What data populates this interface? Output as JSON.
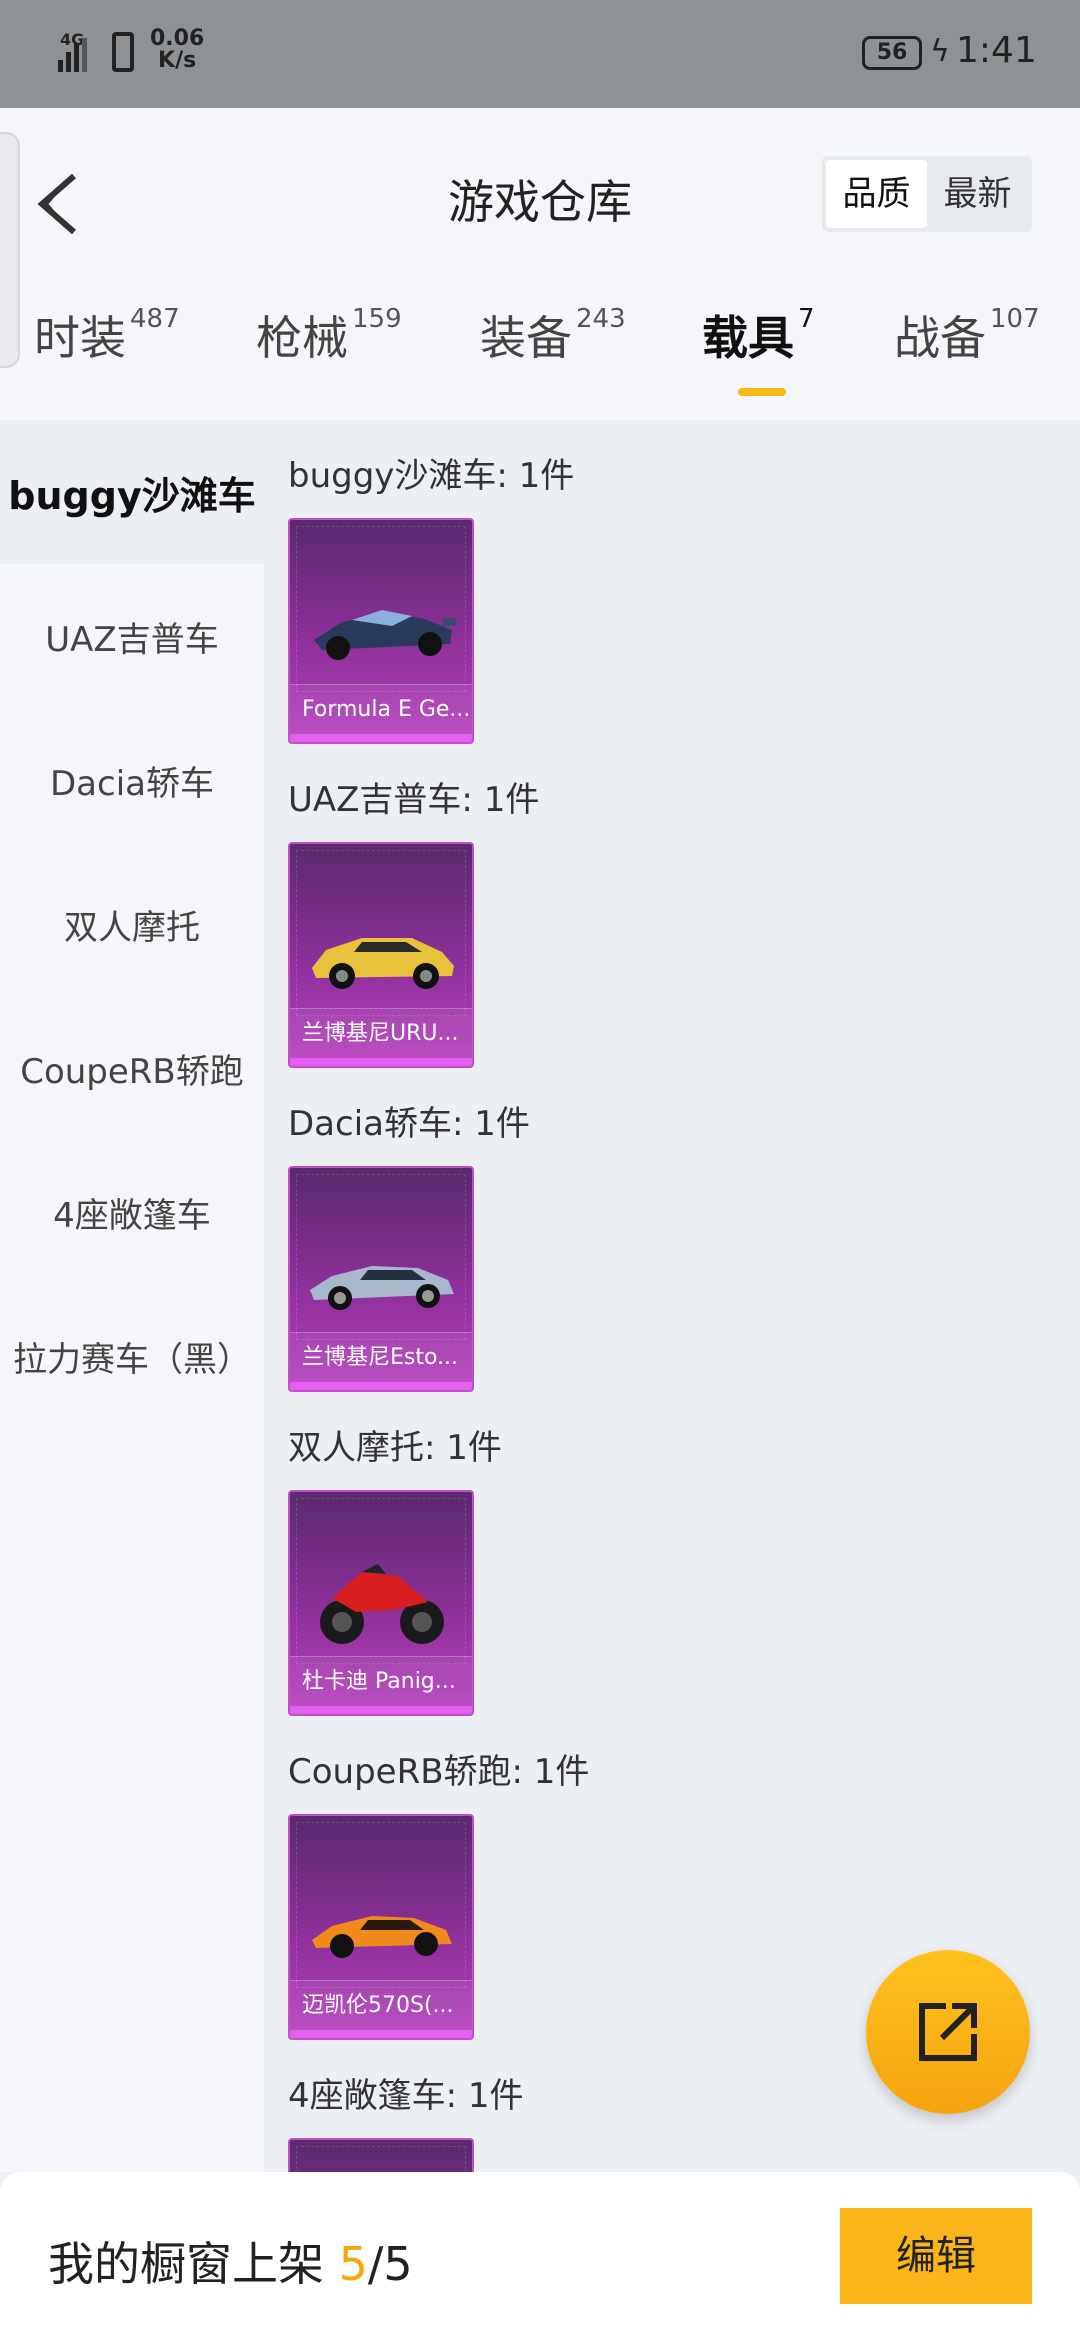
{
  "status_bar": {
    "network": "4G",
    "speed_value": "0.06",
    "speed_unit": "K/s",
    "battery": "56",
    "time": "1:41"
  },
  "header": {
    "title": "游戏仓库",
    "sort_options": [
      "品质",
      "最新"
    ],
    "active_sort": "品质"
  },
  "tabs": [
    {
      "label": "时装",
      "count": "487"
    },
    {
      "label": "枪械",
      "count": "159"
    },
    {
      "label": "装备",
      "count": "243"
    },
    {
      "label": "载具",
      "count": "7"
    },
    {
      "label": "战备",
      "count": "107"
    }
  ],
  "active_tab": "载具",
  "sidebar": {
    "items": [
      {
        "label": "buggy沙滩车"
      },
      {
        "label": "UAZ吉普车"
      },
      {
        "label": "Dacia轿车"
      },
      {
        "label": "双人摩托"
      },
      {
        "label": "CoupeRB轿跑"
      },
      {
        "label": "4座敞篷车"
      },
      {
        "label": "拉力赛车（黑）"
      }
    ],
    "active": "buggy沙滩车"
  },
  "groups": [
    {
      "title": "buggy沙滩车: 1件",
      "item_name": "Formula E Ge...",
      "icon": "formula-car-icon"
    },
    {
      "title": "UAZ吉普车: 1件",
      "item_name": "兰博基尼URU...",
      "icon": "yellow-suv-icon"
    },
    {
      "title": "Dacia轿车: 1件",
      "item_name": "兰博基尼Esto...",
      "icon": "silver-car-icon"
    },
    {
      "title": "双人摩托: 1件",
      "item_name": "杜卡迪 Panig...",
      "icon": "red-motorcycle-icon"
    },
    {
      "title": "CoupeRB轿跑: 1件",
      "item_name": "迈凯伦570S(...",
      "icon": "orange-car-icon"
    },
    {
      "title": "4座敞篷车: 1件",
      "item_name": "",
      "icon": "vehicle-icon"
    }
  ],
  "bottom_bar": {
    "label": "我的橱窗上架",
    "current": "5",
    "separator": "/",
    "total": "5",
    "edit_label": "编辑"
  },
  "colors": {
    "accent": "#f9b519",
    "card_purple": "#8a2f96",
    "count_highlight": "#f5a80c"
  }
}
